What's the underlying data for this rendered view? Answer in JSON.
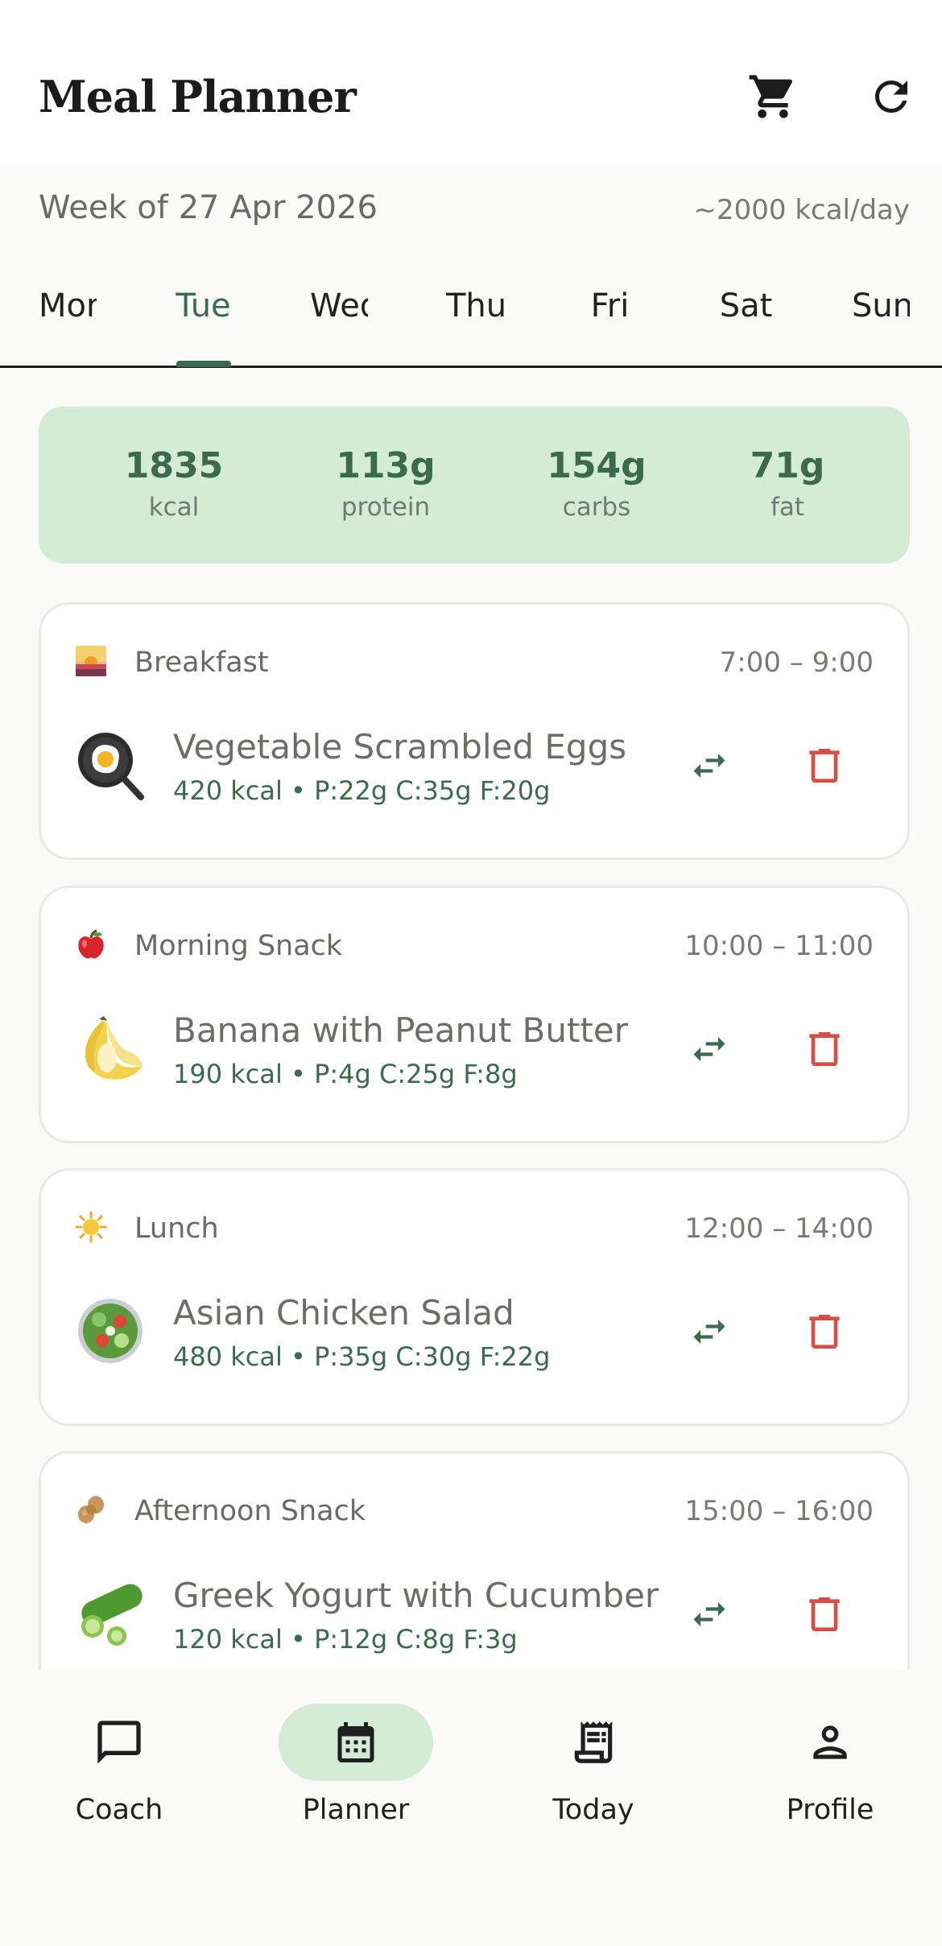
{
  "app": {
    "title": "Meal Planner",
    "icons": {
      "cart": "cart-icon",
      "refresh": "refresh-icon"
    }
  },
  "week": {
    "label": "Week of 27 Apr 2026",
    "kcal_target": "~2000 kcal/day"
  },
  "days": [
    {
      "label": "Mon",
      "selected": false
    },
    {
      "label": "Tue",
      "selected": true
    },
    {
      "label": "Wed",
      "selected": false
    },
    {
      "label": "Thu",
      "selected": false
    },
    {
      "label": "Fri",
      "selected": false
    },
    {
      "label": "Sat",
      "selected": false
    },
    {
      "label": "Sun",
      "selected": false
    }
  ],
  "summary": {
    "kcal": {
      "value": "1835",
      "label": "kcal"
    },
    "protein": {
      "value": "113g",
      "label": "protein"
    },
    "carbs": {
      "value": "154g",
      "label": "carbs"
    },
    "fat": {
      "value": "71g",
      "label": "fat"
    }
  },
  "meals": [
    {
      "type": "Breakfast",
      "time": "7:00 – 9:00",
      "type_icon": "sunrise-icon",
      "food_icon": "frying-pan-egg-icon",
      "food": "Vegetable Scrambled Eggs",
      "macros": "420 kcal • P:22g C:35g F:20g"
    },
    {
      "type": "Morning Snack",
      "time": "10:00 – 11:00",
      "type_icon": "apple-icon",
      "food_icon": "banana-icon",
      "food": "Banana with Peanut Butter",
      "macros": "190 kcal • P:4g C:25g F:8g"
    },
    {
      "type": "Lunch",
      "time": "12:00 – 14:00",
      "type_icon": "sun-icon",
      "food_icon": "salad-icon",
      "food": "Asian Chicken Salad",
      "macros": "480 kcal • P:35g C:30g F:22g"
    },
    {
      "type": "Afternoon Snack",
      "time": "15:00 – 16:00",
      "type_icon": "peanut-icon",
      "food_icon": "cucumber-icon",
      "food": "Greek Yogurt with Cucumber",
      "macros": "120 kcal • P:12g C:8g F:3g"
    }
  ],
  "nav": [
    {
      "label": "Coach",
      "icon": "chat-icon",
      "active": false
    },
    {
      "label": "Planner",
      "icon": "calendar-icon",
      "active": true
    },
    {
      "label": "Today",
      "icon": "receipt-icon",
      "active": false
    },
    {
      "label": "Profile",
      "icon": "person-icon",
      "active": false
    }
  ],
  "colors": {
    "accent": "#3d6a4e",
    "summary_bg": "#d4ecd5",
    "delete": "#d64f45",
    "background": "#fafaf8"
  }
}
